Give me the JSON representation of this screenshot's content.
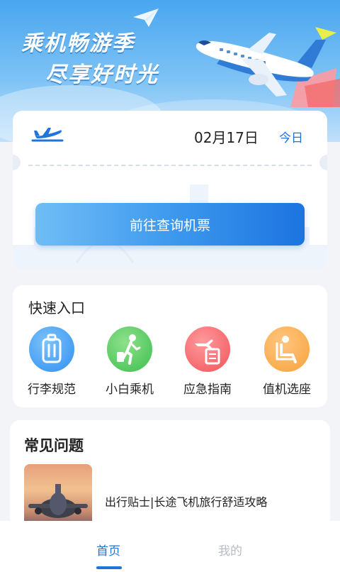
{
  "banner": {
    "slogan_line1": "乘机畅游季",
    "slogan_line2": "尽享好时光"
  },
  "ticket": {
    "date": "02月17日",
    "today_label": "今日",
    "search_button": "前往查询机票"
  },
  "quick_entry": {
    "title": "快速入口",
    "items": [
      {
        "label": "行李规范",
        "icon": "luggage-icon",
        "color": "#2f8ff0"
      },
      {
        "label": "小白乘机",
        "icon": "walking-traveler-icon",
        "color": "#3cbf4e"
      },
      {
        "label": "应急指南",
        "icon": "flight-document-icon",
        "color": "#f0545a"
      },
      {
        "label": "值机选座",
        "icon": "seat-icon",
        "color": "#f7a23a"
      }
    ]
  },
  "faq": {
    "title": "常见问题",
    "items": [
      {
        "text": "出行贴士|长途飞机旅行舒适攻略"
      }
    ]
  },
  "nav": {
    "home": "首页",
    "mine": "我的"
  },
  "colors": {
    "accent": "#1e74d8",
    "banner_top": "#4aa6ef",
    "page_bg": "#f2f4f7"
  }
}
